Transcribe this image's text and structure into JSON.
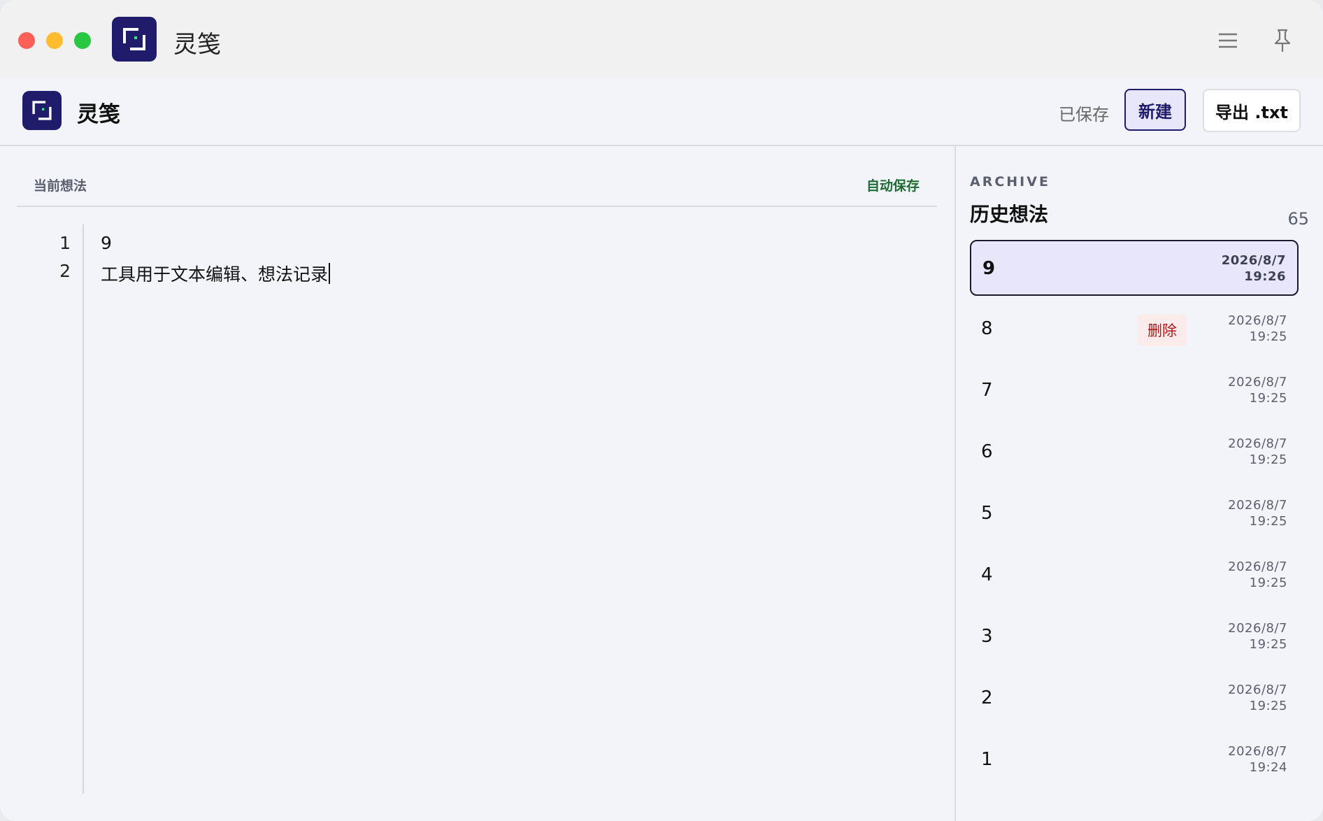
{
  "titlebar": {
    "app_name": "灵笺"
  },
  "header": {
    "app_name": "灵笺",
    "save_status": "已保存",
    "new_label": "新建",
    "export_label": "导出 .txt"
  },
  "editor": {
    "label": "当前想法",
    "autosave_label": "自动保存",
    "lines": [
      {
        "no": "1",
        "text": "9"
      },
      {
        "no": "2",
        "text": "工具用于文本编辑、想法记录"
      }
    ]
  },
  "sidebar": {
    "eyebrow": "ARCHIVE",
    "title": "历史想法",
    "count": "65",
    "items": [
      {
        "name": "9",
        "date": "2026/8/7",
        "time": "19:26",
        "active": true
      },
      {
        "name": "8",
        "date": "2026/8/7",
        "time": "19:25",
        "delete_label": "删除"
      },
      {
        "name": "7",
        "date": "2026/8/7",
        "time": "19:25"
      },
      {
        "name": "6",
        "date": "2026/8/7",
        "time": "19:25"
      },
      {
        "name": "5",
        "date": "2026/8/7",
        "time": "19:25"
      },
      {
        "name": "4",
        "date": "2026/8/7",
        "time": "19:25"
      },
      {
        "name": "3",
        "date": "2026/8/7",
        "time": "19:25"
      },
      {
        "name": "2",
        "date": "2026/8/7",
        "time": "19:25"
      },
      {
        "name": "1",
        "date": "2026/8/7",
        "time": "19:24"
      }
    ]
  },
  "icons": {
    "close": "traffic-close-icon",
    "minimize": "traffic-minimize-icon",
    "maximize": "traffic-maximize-icon",
    "menu": "hamburger-menu-icon",
    "pin": "pin-icon",
    "app": "app-logo-icon"
  },
  "colors": {
    "brand": "#1f1c6b",
    "active_bg": "#e7e6fb",
    "autosave": "#1d6b33",
    "delete": "#b01818",
    "delete_bg": "#fcebeb"
  }
}
